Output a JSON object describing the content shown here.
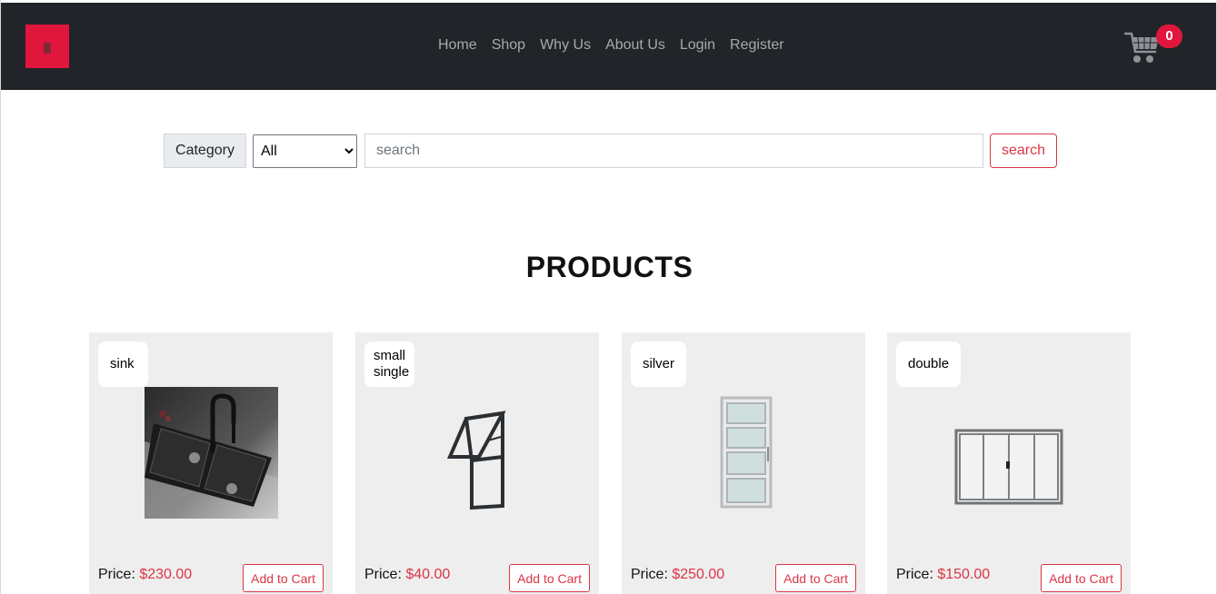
{
  "header": {
    "nav": [
      "Home",
      "Shop",
      "Why Us",
      "About Us",
      "Login",
      "Register"
    ],
    "cart_count": "0",
    "accent_color": "#e0163c",
    "background_color": "#212429"
  },
  "search": {
    "category_label": "Category",
    "category_selected": "All",
    "placeholder": "search",
    "button_label": "search"
  },
  "main": {
    "title": "PRODUCTS"
  },
  "products": [
    {
      "name": "sink",
      "price_label": "Price:",
      "price": "$230.00",
      "button": "Add to Cart",
      "image": "black double sink with faucet"
    },
    {
      "name": "small single",
      "price_label": "Price:",
      "price": "$40.00",
      "button": "Add to Cart",
      "image": "dark frame window"
    },
    {
      "name": "silver",
      "price_label": "Price:",
      "price": "$250.00",
      "button": "Add to Cart",
      "image": "silver aluminium door"
    },
    {
      "name": "double",
      "price_label": "Price:",
      "price": "$150.00",
      "button": "Add to Cart",
      "image": "double sliding window"
    }
  ]
}
